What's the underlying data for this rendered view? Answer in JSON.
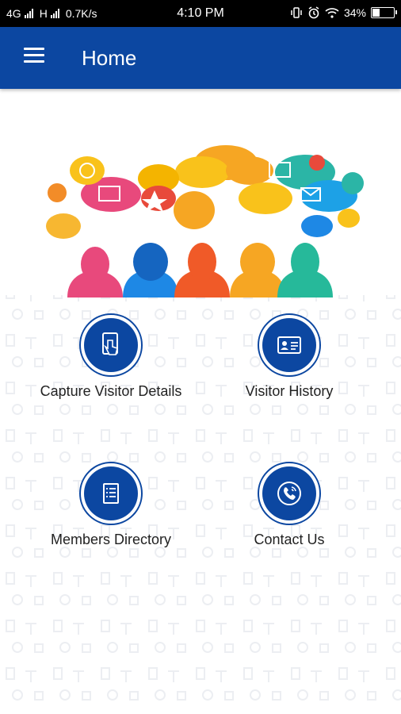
{
  "status_bar": {
    "network_1": "4G",
    "network_2": "H",
    "speed": "0.7K/s",
    "time": "4:10 PM",
    "battery_percent": "34%",
    "battery_level": 0.34
  },
  "app_bar": {
    "menu_icon": "hamburger-menu-icon",
    "title": "Home"
  },
  "hero": {
    "icon": "social-people-chat-illustration"
  },
  "tiles": [
    {
      "label": "Capture Visitor Details",
      "icon": "tablet-touch-icon"
    },
    {
      "label": "Visitor History",
      "icon": "id-card-icon"
    },
    {
      "label": "Members Directory",
      "icon": "list-book-icon"
    },
    {
      "label": "Contact Us",
      "icon": "phone-call-icon"
    }
  ],
  "colors": {
    "primary": "#0c47a1",
    "status_bar": "#000000",
    "background": "#ffffff"
  }
}
